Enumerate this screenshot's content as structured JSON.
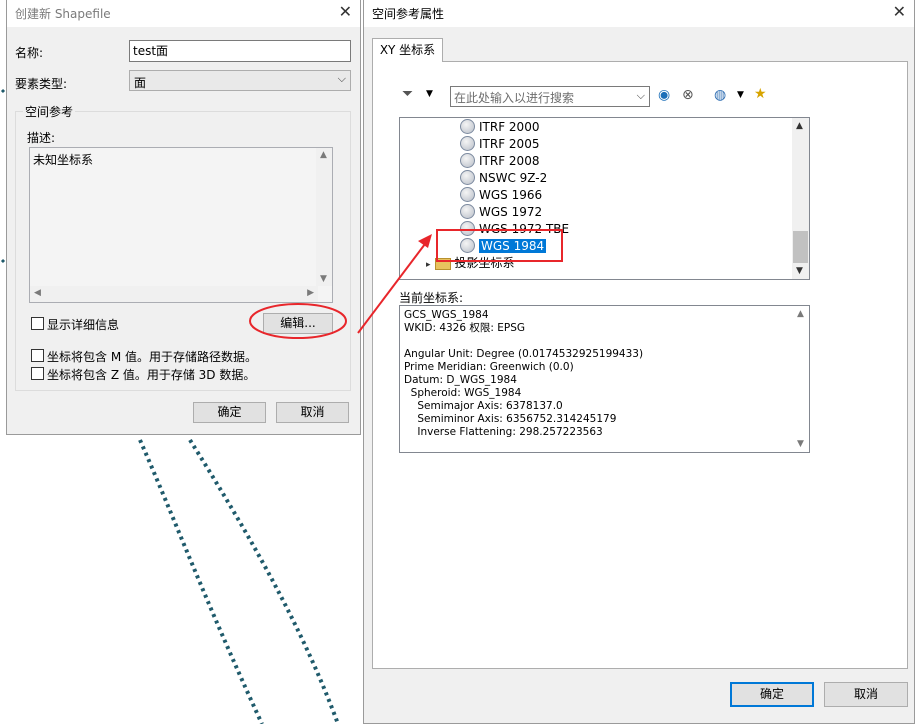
{
  "left_dialog": {
    "title": "创建新 Shapefile",
    "name_label": "名称:",
    "name_value": "test面",
    "feature_type_label": "要素类型:",
    "feature_type_value": "面",
    "spatial_ref_group": "空间参考",
    "description_label": "描述:",
    "description_value": "未知坐标系",
    "show_details_label": "显示详细信息",
    "edit_button": "编辑...",
    "m_values_label": "坐标将包含 M 值。用于存储路径数据。",
    "z_values_label": "坐标将包含 Z 值。用于存储 3D 数据。",
    "ok_button": "确定",
    "cancel_button": "取消"
  },
  "right_dialog": {
    "title": "空间参考属性",
    "tab_label": "XY 坐标系",
    "search_placeholder": "在此处输入以进行搜索",
    "tree_items": [
      {
        "label": "ITRF 2000"
      },
      {
        "label": "ITRF 2005"
      },
      {
        "label": "ITRF 2008"
      },
      {
        "label": "NSWC 9Z-2"
      },
      {
        "label": "WGS 1966"
      },
      {
        "label": "WGS 1972"
      },
      {
        "label": "WGS 1972 TBE"
      },
      {
        "label": "WGS 1984",
        "selected": true
      }
    ],
    "projected_folder": "投影坐标系",
    "current_cs_label": "当前坐标系:",
    "current_cs_lines": [
      "GCS_WGS_1984",
      "WKID: 4326 权限: EPSG",
      "",
      "Angular Unit: Degree (0.0174532925199433)",
      "Prime Meridian: Greenwich (0.0)",
      "Datum: D_WGS_1984",
      "  Spheroid: WGS_1984",
      "    Semimajor Axis: 6378137.0",
      "    Semiminor Axis: 6356752.314245179",
      "    Inverse Flattening: 298.257223563"
    ],
    "ok_button": "确定",
    "cancel_button": "取消"
  },
  "colors": {
    "selection": "#0078d7",
    "annotation": "#e8262b",
    "dots": "#1f5a6b"
  }
}
